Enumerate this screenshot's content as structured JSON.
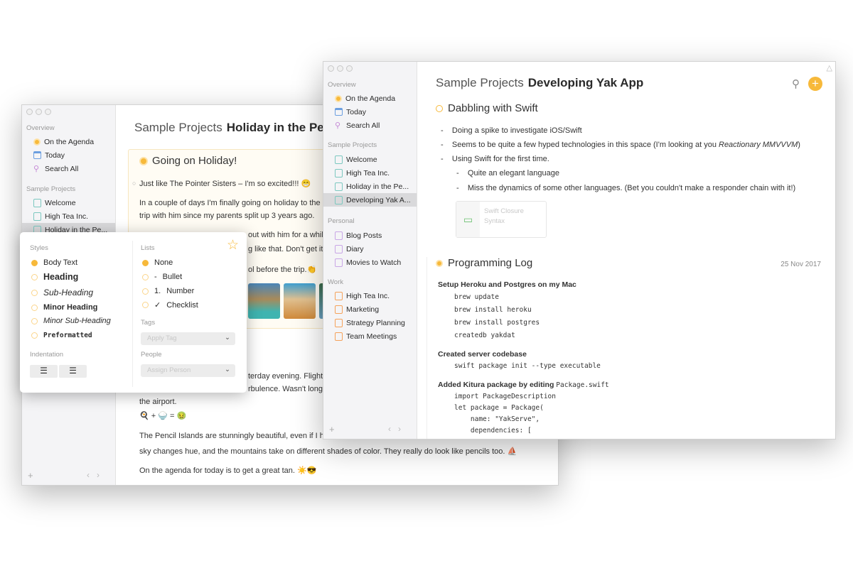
{
  "back": {
    "sidebar": {
      "overview": "Overview",
      "items": [
        "On the Agenda",
        "Today",
        "Search All"
      ],
      "projects_header": "Sample Projects",
      "projects": [
        "Welcome",
        "High Tea Inc.",
        "Holiday in the Pe..."
      ]
    },
    "title": {
      "group": "Sample Projects",
      "name": "Holiday in the Pencil"
    },
    "card": {
      "heading": "Going on Holiday!",
      "lines": [
        "Just like The Pointer Sisters – I'm so excited!!! 😁",
        "In a couple of days I'm finally going on holiday to the P",
        "trip with him since my parents split up 3 years ago.",
        "out with him for a whil",
        "g like that. Don't get it",
        "ol before the trip.👏"
      ]
    },
    "body": [
      "terday evening. Flight",
      "rbulence. Wasn't long b",
      "the airport.",
      "🍳 + 🍚 = 🤢",
      "The Pencil Islands are stunningly beautiful, even if I ha",
      "sky changes hue, and the mountains take on different shades of color. They really do look like pencils too. ⛵",
      "On the agenda for today is to get a great tan. ☀️😎"
    ]
  },
  "popover": {
    "styles_label": "Styles",
    "styles": [
      "Body Text",
      "Heading",
      "Sub-Heading",
      "Minor Heading",
      "Minor Sub-Heading",
      "Preformatted"
    ],
    "selected_style": "Body Text",
    "lists_label": "Lists",
    "lists": [
      {
        "m": "",
        "l": "None"
      },
      {
        "m": "-",
        "l": "Bullet"
      },
      {
        "m": "1.",
        "l": "Number"
      },
      {
        "m": "✓",
        "l": "Checklist"
      }
    ],
    "selected_list": "None",
    "tags_label": "Tags",
    "tags_placeholder": "Apply Tag",
    "people_label": "People",
    "people_placeholder": "Assign Person",
    "indent_label": "Indentation"
  },
  "front": {
    "sidebar": {
      "overview": "Overview",
      "items": [
        "On the Agenda",
        "Today",
        "Search All"
      ],
      "projects_header": "Sample Projects",
      "projects": [
        "Welcome",
        "High Tea Inc.",
        "Holiday in the Pe...",
        "Developing Yak A..."
      ],
      "personal_header": "Personal",
      "personal": [
        "Blog Posts",
        "Diary",
        "Movies to Watch"
      ],
      "work_header": "Work",
      "work": [
        "High Tea Inc.",
        "Marketing",
        "Strategy Planning",
        "Team Meetings"
      ]
    },
    "title": {
      "group": "Sample Projects",
      "name": "Developing Yak App"
    },
    "section1": {
      "heading": "Dabbling with Swift",
      "bullets": [
        "Doing a spike to investigate iOS/Swift",
        "Seems to be quite a few hyped technologies in this space (I'm looking at you ",
        "Using Swift for the first time."
      ],
      "bullet2_em": "Reactionary MMVVVM",
      "bullet2_end": ")",
      "sub": [
        "Quite an elegant language",
        "Miss the dynamics of some other languages. (Bet you couldn't make a responder chain with it!)"
      ],
      "attachment": [
        "Swift Closure",
        "Syntax"
      ]
    },
    "section2": {
      "heading": "Programming Log",
      "date": "25 Nov 2017",
      "h1": "Setup Heroku and Postgres on my Mac",
      "c1": [
        "brew update",
        "brew install heroku",
        "brew install postgres",
        "createdb yakdat"
      ],
      "h2": "Created server codebase",
      "c2": [
        "swift package init --type executable"
      ],
      "h3": "Added Kitura package by editing ",
      "h3code": "Package.swift",
      "c3": [
        "import PackageDescription",
        "let package = Package(",
        "    name: \"YakServe\",",
        "    dependencies: ["
      ]
    },
    "accent": "#f7b93a"
  }
}
